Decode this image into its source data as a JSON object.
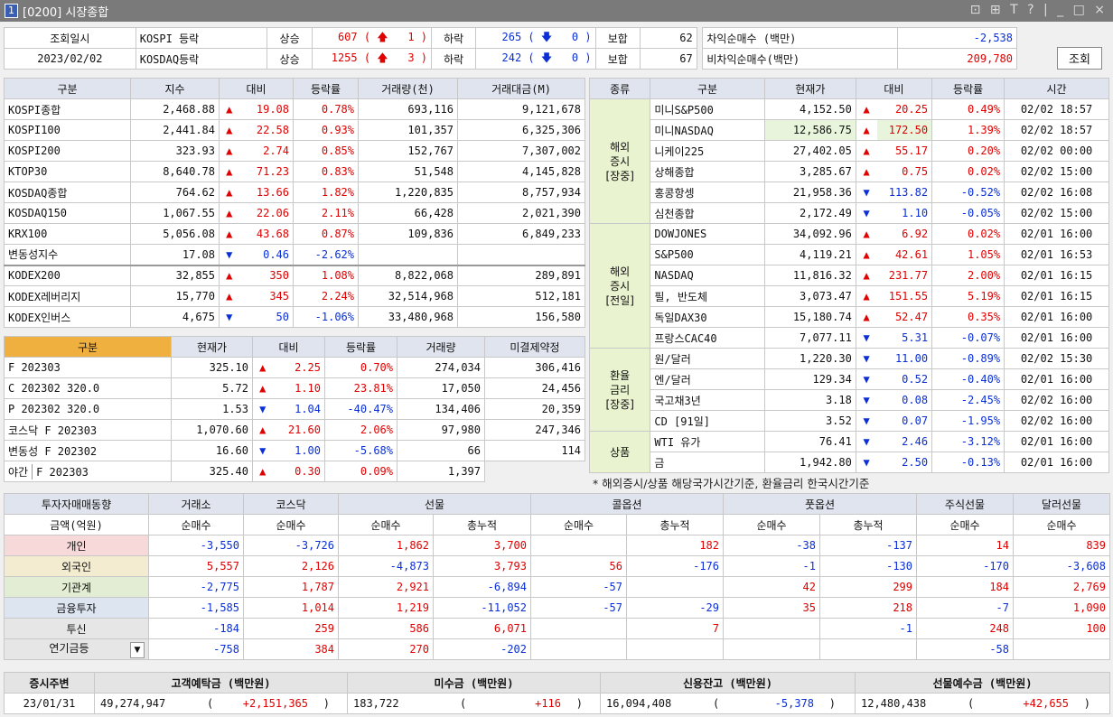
{
  "title": {
    "num": "1",
    "text": "[0200] 시장종합",
    "ctrls": "⊡ ⊞ T ? | _ □ ×"
  },
  "top": {
    "inq_label": "조회일시",
    "date": "2023/02/02",
    "rows": [
      {
        "name": "KOSPI 등락",
        "up_label": "상승",
        "up_val": "607 ( ",
        "up_lim": "1 )",
        "down_label": "하락",
        "down_val": "265 ( ",
        "down_lim": "0 )",
        "flat_label": "보합",
        "flat_val": "62"
      },
      {
        "name": "KOSDAQ등락",
        "up_label": "상승",
        "up_val": "1255 ( ",
        "up_lim": "3 )",
        "down_label": "하락",
        "down_val": "242 ( ",
        "down_lim": "0 )",
        "flat_label": "보합",
        "flat_val": "67"
      }
    ],
    "arb": [
      {
        "label": "차익순매수  (백만)",
        "val": "-2,538"
      },
      {
        "label": "비차익순매수(백만)",
        "val": "209,780"
      }
    ],
    "btn": "조회"
  },
  "idx": {
    "headers": [
      "구분",
      "지수",
      "대비",
      "등락률",
      "거래량(천)",
      "거래대금(M)"
    ],
    "rows": [
      [
        "KOSPI종합",
        "2,468.88",
        "▲",
        "19.08",
        "0.78%",
        "693,116",
        "9,121,678",
        "u"
      ],
      [
        "KOSPI100",
        "2,441.84",
        "▲",
        "22.58",
        "0.93%",
        "101,357",
        "6,325,306",
        "u"
      ],
      [
        "KOSPI200",
        "323.93",
        "▲",
        "2.74",
        "0.85%",
        "152,767",
        "7,307,002",
        "u"
      ],
      [
        "KTOP30",
        "8,640.78",
        "▲",
        "71.23",
        "0.83%",
        "51,548",
        "4,145,828",
        "u"
      ],
      [
        "KOSDAQ종합",
        "764.62",
        "▲",
        "13.66",
        "1.82%",
        "1,220,835",
        "8,757,934",
        "u"
      ],
      [
        "KOSDAQ150",
        "1,067.55",
        "▲",
        "22.06",
        "2.11%",
        "66,428",
        "2,021,390",
        "u"
      ],
      [
        "KRX100",
        "5,056.08",
        "▲",
        "43.68",
        "0.87%",
        "109,836",
        "6,849,233",
        "u"
      ],
      [
        "변동성지수",
        "17.08",
        "▼",
        "0.46",
        "-2.62%",
        "",
        "",
        "d"
      ],
      [
        "KODEX200",
        "32,855",
        "▲",
        "350",
        "1.08%",
        "8,822,068",
        "289,891",
        "u"
      ],
      [
        "KODEX레버리지",
        "15,770",
        "▲",
        "345",
        "2.24%",
        "32,514,968",
        "512,181",
        "u"
      ],
      [
        "KODEX인버스",
        "4,675",
        "▼",
        "50",
        "-1.06%",
        "33,480,968",
        "156,580",
        "d"
      ]
    ]
  },
  "fut": {
    "headers": [
      "구분",
      "현재가",
      "대비",
      "등락률",
      "거래량",
      "미결제약정"
    ],
    "rows": [
      [
        "F 202303",
        "325.10",
        "▲",
        "2.25",
        "0.70%",
        "274,034",
        "306,416",
        "u"
      ],
      [
        "C 202302 320.0",
        "5.72",
        "▲",
        "1.10",
        "23.81%",
        "17,050",
        "24,456",
        "u"
      ],
      [
        "P 202302 320.0",
        "1.53",
        "▼",
        "1.04",
        "-40.47%",
        "134,406",
        "20,359",
        "d"
      ],
      [
        "코스닥 F 202303",
        "1,070.60",
        "▲",
        "21.60",
        "2.06%",
        "97,980",
        "247,346",
        "u"
      ],
      [
        "변동성 F 202302",
        "16.60",
        "▼",
        "1.00",
        "-5.68%",
        "66",
        "114",
        "d"
      ]
    ],
    "night": {
      "tag": "야간",
      "name": "F 202303",
      "price": "325.40",
      "arrow": "▲",
      "chg": "0.30",
      "rate": "0.09%",
      "vol": "1,397"
    }
  },
  "world": {
    "headers": [
      "종류",
      "구분",
      "현재가",
      "대비",
      "등락률",
      "시간"
    ],
    "groups": [
      {
        "label": "해외\n증시\n[장중]",
        "rows": [
          [
            "미니S&P500",
            "4,152.50",
            "▲",
            "20.25",
            "0.49%",
            "02/02 18:57",
            "u"
          ],
          [
            "미니NASDAQ",
            "12,586.75",
            "▲",
            "172.50",
            "1.39%",
            "02/02 18:57",
            "u"
          ],
          [
            "니케이225",
            "27,402.05",
            "▲",
            "55.17",
            "0.20%",
            "02/02 00:00",
            "u"
          ],
          [
            "상해종합",
            "3,285.67",
            "▲",
            "0.75",
            "0.02%",
            "02/02 15:00",
            "u"
          ],
          [
            "홍콩항셍",
            "21,958.36",
            "▼",
            "113.82",
            "-0.52%",
            "02/02 16:08",
            "d"
          ],
          [
            "심천종합",
            "2,172.49",
            "▼",
            "1.10",
            "-0.05%",
            "02/02 15:00",
            "d"
          ]
        ]
      },
      {
        "label": "해외\n증시\n[전일]",
        "rows": [
          [
            "DOWJONES",
            "34,092.96",
            "▲",
            "6.92",
            "0.02%",
            "02/01 16:00",
            "u"
          ],
          [
            "S&P500",
            "4,119.21",
            "▲",
            "42.61",
            "1.05%",
            "02/01 16:53",
            "u"
          ],
          [
            "NASDAQ",
            "11,816.32",
            "▲",
            "231.77",
            "2.00%",
            "02/01 16:15",
            "u"
          ],
          [
            "필, 반도체",
            "3,073.47",
            "▲",
            "151.55",
            "5.19%",
            "02/01 16:15",
            "u"
          ],
          [
            "독일DAX30",
            "15,180.74",
            "▲",
            "52.47",
            "0.35%",
            "02/01 16:00",
            "u"
          ],
          [
            "프랑스CAC40",
            "7,077.11",
            "▼",
            "5.31",
            "-0.07%",
            "02/01 16:00",
            "d"
          ]
        ]
      },
      {
        "label": "환율\n금리\n[장중]",
        "rows": [
          [
            "원/달러",
            "1,220.30",
            "▼",
            "11.00",
            "-0.89%",
            "02/02 15:30",
            "d"
          ],
          [
            "엔/달러",
            "129.34",
            "▼",
            "0.52",
            "-0.40%",
            "02/01 16:00",
            "d"
          ],
          [
            "국고채3년",
            "3.18",
            "▼",
            "0.08",
            "-2.45%",
            "02/02 16:00",
            "d"
          ],
          [
            "CD [91일]",
            "3.52",
            "▼",
            "0.07",
            "-1.95%",
            "02/02 16:00",
            "d"
          ]
        ]
      },
      {
        "label": "상품",
        "rows": [
          [
            "WTI 유가",
            "76.41",
            "▼",
            "2.46",
            "-3.12%",
            "02/01 16:00",
            "d"
          ],
          [
            "금",
            "1,942.80",
            "▼",
            "2.50",
            "-0.13%",
            "02/01 16:00",
            "d"
          ]
        ]
      }
    ],
    "note": "* 해외증시/상품 해당국가시간기준, 환율금리 한국시간기준"
  },
  "inv": {
    "h1": [
      "투자자매매동향",
      "거래소",
      "코스닥",
      "선물",
      "",
      "콜옵션",
      "",
      "풋옵션",
      "",
      "주식선물",
      "달러선물"
    ],
    "h2": [
      "금액(억원)",
      "순매수",
      "순매수",
      "순매수",
      "총누적",
      "순매수",
      "총누적",
      "순매수",
      "총누적",
      "순매수",
      "순매수"
    ],
    "rows": [
      [
        "개인",
        "-3,550",
        "-3,726",
        "1,862",
        "3,700",
        "",
        "182",
        "-38",
        "-137",
        "14",
        "839"
      ],
      [
        "외국인",
        "5,557",
        "2,126",
        "-4,873",
        "3,793",
        "56",
        "-176",
        "-1",
        "-130",
        "-170",
        "-3,608"
      ],
      [
        "기관계",
        "-2,775",
        "1,787",
        "2,921",
        "-6,894",
        "-57",
        "",
        "42",
        "299",
        "184",
        "2,769"
      ],
      [
        "금융투자",
        "-1,585",
        "1,014",
        "1,219",
        "-11,052",
        "-57",
        "-29",
        "35",
        "218",
        "-7",
        "1,090"
      ],
      [
        "투신",
        "-184",
        "259",
        "586",
        "6,071",
        "",
        "7",
        "",
        "-1",
        "248",
        "100"
      ],
      [
        "연기금등",
        "-758",
        "384",
        "270",
        "-202",
        "",
        "",
        "",
        "",
        "-58",
        ""
      ]
    ]
  },
  "sum": {
    "h": [
      "증시주변",
      "고객예탁금 (백만원)",
      "미수금 (백만원)",
      "신용잔고 (백만원)",
      "선물예수금 (백만원)"
    ],
    "date": "23/01/31",
    "vals": [
      [
        "49,274,947",
        "+2,151,365",
        "r"
      ],
      [
        "183,722",
        "+116",
        "r"
      ],
      [
        "16,094,408",
        "-5,378",
        "b"
      ],
      [
        "12,480,438",
        "+42,655",
        "r"
      ]
    ]
  }
}
